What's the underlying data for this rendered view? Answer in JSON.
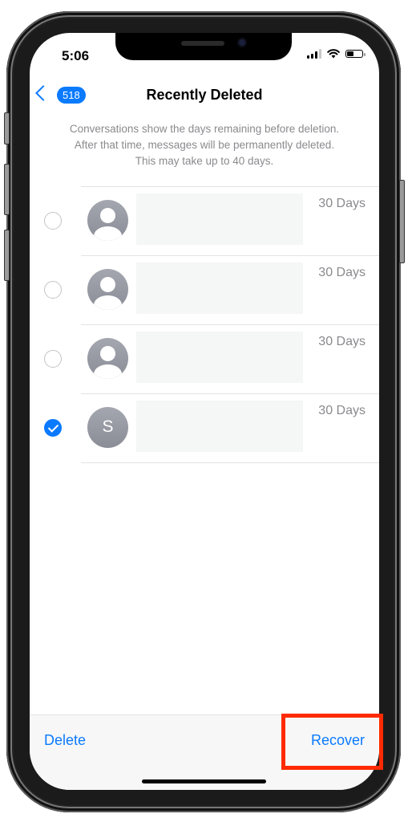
{
  "status_bar": {
    "time": "5:06",
    "icons": [
      "cellular-signal-icon",
      "wifi-icon",
      "battery-icon"
    ],
    "battery_level_percent": 45
  },
  "nav": {
    "back_icon": "chevron-left-icon",
    "back_badge": "518",
    "title": "Recently Deleted"
  },
  "info_text": {
    "line1": "Conversations show the days remaining before deletion.",
    "line2": "After that time, messages will be permanently deleted.",
    "line3": "This may take up to 40 days."
  },
  "conversations": [
    {
      "avatar": "person-placeholder",
      "initial": "",
      "days": "30 Days",
      "selected": false
    },
    {
      "avatar": "person-placeholder",
      "initial": "",
      "days": "30 Days",
      "selected": false
    },
    {
      "avatar": "person-placeholder",
      "initial": "",
      "days": "30 Days",
      "selected": false
    },
    {
      "avatar": "initial",
      "initial": "S",
      "days": "30 Days",
      "selected": true
    }
  ],
  "toolbar": {
    "delete_label": "Delete",
    "recover_label": "Recover"
  },
  "colors": {
    "accent": "#0a7aff",
    "highlight": "#ff2a00",
    "secondary_text": "#8a8a8e"
  }
}
